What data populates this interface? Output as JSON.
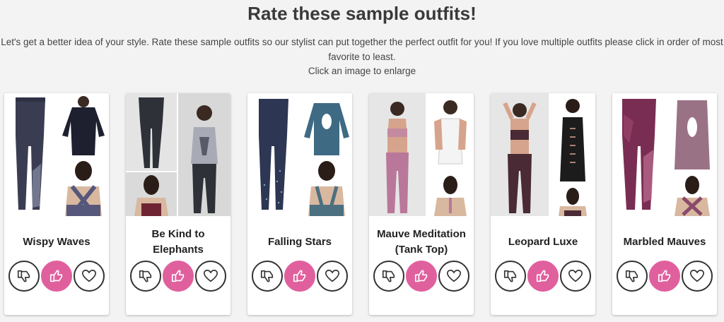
{
  "header": {
    "title": "Rate these sample outfits!",
    "description": "Let's get a better idea of your style. Rate these sample outfits so our stylist can put together the perfect outfit for you! If you love multiple outfits please click in order of most favorite to least.",
    "hint": "Click an image to enlarge"
  },
  "colors": {
    "like_active": "#e0609e",
    "icon_dark": "#333333"
  },
  "outfits": [
    {
      "name": "Wispy Waves",
      "selected": "like",
      "icons": [
        "thumbs-down-icon",
        "thumbs-up-icon",
        "heart-icon"
      ]
    },
    {
      "name": "Be Kind to Elephants",
      "selected": "like",
      "icons": [
        "thumbs-down-icon",
        "thumbs-up-icon",
        "heart-icon"
      ]
    },
    {
      "name": "Falling Stars",
      "selected": "like",
      "icons": [
        "thumbs-down-icon",
        "thumbs-up-icon",
        "heart-icon"
      ]
    },
    {
      "name": "Mauve Meditation (Tank Top)",
      "selected": "like",
      "icons": [
        "thumbs-down-icon",
        "thumbs-up-icon",
        "heart-icon"
      ]
    },
    {
      "name": "Leopard Luxe",
      "selected": "like",
      "icons": [
        "thumbs-down-icon",
        "thumbs-up-icon",
        "heart-icon"
      ]
    },
    {
      "name": "Marbled Mauves",
      "selected": "like",
      "icons": [
        "thumbs-down-icon",
        "thumbs-up-icon",
        "heart-icon"
      ]
    }
  ]
}
